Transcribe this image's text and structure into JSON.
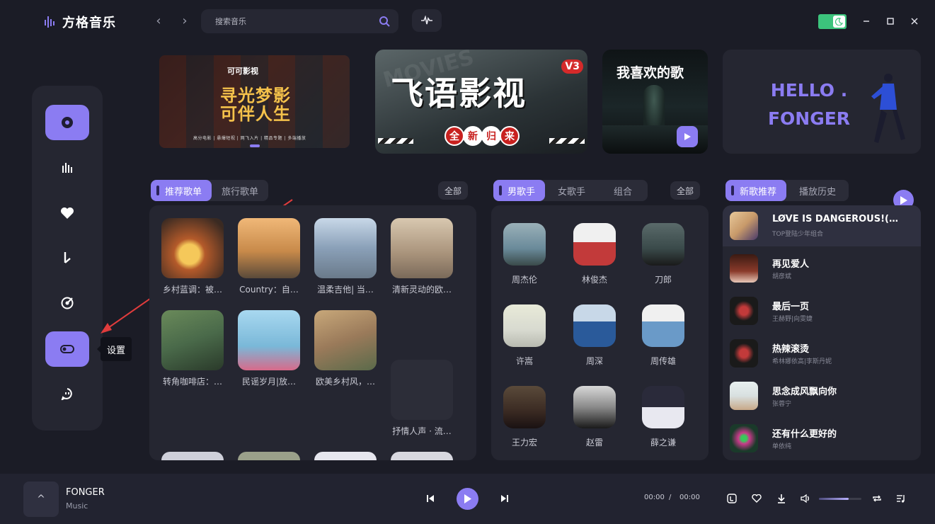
{
  "app": {
    "name": "方格音乐"
  },
  "search": {
    "placeholder": "搜索音乐"
  },
  "sidebar": {
    "tooltip": "设置"
  },
  "banners": {
    "b1_brand": "可可影视",
    "b1_headline": "寻光梦影 可伴人生",
    "b1_tags": "高分电影 | 悬爆短视 | 网飞入片 | 精品专题 | 多端播放",
    "b2_title": "飞语影视",
    "b2_ver": "V3",
    "b2_chips": [
      "全",
      "新",
      "归",
      "来"
    ],
    "b2_bg": "MOVIES",
    "b3_title": "我喜欢的歌",
    "b4_hello": "HELLO .",
    "b4_name": "FONGER"
  },
  "playlists": {
    "tabs": [
      "推荐歌单",
      "旅行歌单"
    ],
    "all_label": "全部",
    "items": [
      {
        "name": "乡村蓝调：被…",
        "color": "#b45a2a"
      },
      {
        "name": "Country：自…",
        "color": "#c88a4a"
      },
      {
        "name": "温柔吉他| 当…",
        "color": "#8aa0b8"
      },
      {
        "name": "清新灵动的欧…",
        "color": "#a8927a"
      },
      {
        "name": "转角咖啡店：…",
        "color": "#4a6a4a"
      },
      {
        "name": "民谣岁月|放…",
        "color": "#7ab8d8"
      },
      {
        "name": "欧美乡村风，…",
        "color": "#9a7a5a"
      },
      {
        "name": "抒情人声 · 流…",
        "color": "#2c2d38"
      }
    ]
  },
  "artists": {
    "tabs": [
      "男歌手",
      "女歌手",
      "组合"
    ],
    "all_label": "全部",
    "items": [
      {
        "name": "周杰伦",
        "color": "#6a8a9a"
      },
      {
        "name": "林俊杰",
        "color": "#c23a3a"
      },
      {
        "name": "刀郎",
        "color": "#3a4a4a"
      },
      {
        "name": "许嵩",
        "color": "#d8dad0"
      },
      {
        "name": "周深",
        "color": "#2a5a9a"
      },
      {
        "name": "周传雄",
        "color": "#6a9ac8"
      },
      {
        "name": "王力宏",
        "color": "#3a2a22"
      },
      {
        "name": "赵雷",
        "color": "#8a8a8a"
      },
      {
        "name": "薛之谦",
        "color": "#2a2a3a"
      }
    ]
  },
  "songs": {
    "tabs": [
      "新歌推荐",
      "播放历史"
    ],
    "items": [
      {
        "title": "LØVE IS DANGEROUS!(…",
        "artist": "TOP登陆少年组合",
        "color": "#c89a6a"
      },
      {
        "title": "再见爱人",
        "artist": "胡彦斌",
        "color": "#8a3a2a"
      },
      {
        "title": "最后一页",
        "artist": "王赫野|向雯婕",
        "color": "#1a1a1a"
      },
      {
        "title": "热辣滚烫",
        "artist": "希林娜依高|李斯丹妮",
        "color": "#1a1a1a"
      },
      {
        "title": "思念成风飘向你",
        "artist": "张蓉宁",
        "color": "#d8e0e0"
      },
      {
        "title": "还有什么更好的",
        "artist": "单依纯",
        "color": "#1a3a2a"
      }
    ]
  },
  "player": {
    "title": "FONGER",
    "subtitle": "Music",
    "cover_label": "^",
    "current_time": "00:00",
    "separator": "/",
    "total_time": "00:00",
    "volume": 0.7
  }
}
